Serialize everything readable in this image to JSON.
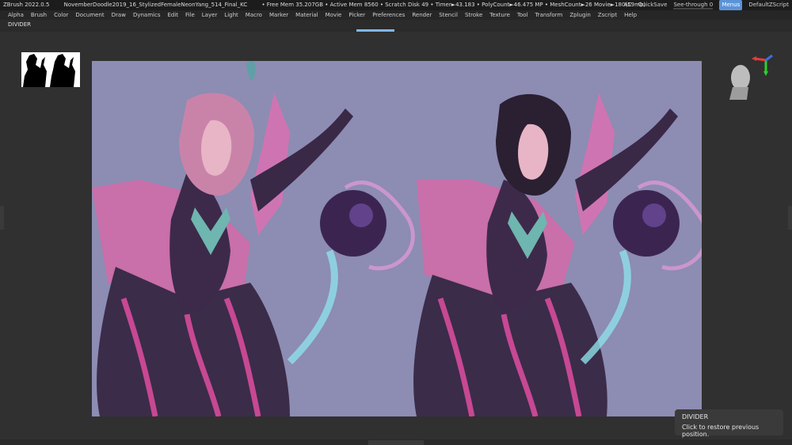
{
  "titlebar": {
    "app": "ZBrush 2022.0.5",
    "file": "NovemberDoodle2019_16_StylizedFemaleNeonYang_514_Final_KC",
    "stats": "• Free Mem 35.207GB • Active Mem 8560 • Scratch Disk 49 • Timer►43.183 • PolyCount►46.475 MP • MeshCount►26  Movie►180(59mb)",
    "ac": "AC",
    "quicksave": "QuickSave",
    "see_through_label": "See-through",
    "see_through_value": "0",
    "see_through_level": 0,
    "menus": "Menus",
    "default_zscript": "DefaultZScript"
  },
  "menubar": {
    "items": [
      "Alpha",
      "Brush",
      "Color",
      "Document",
      "Draw",
      "Dynamics",
      "Edit",
      "File",
      "Layer",
      "Light",
      "Macro",
      "Marker",
      "Material",
      "Movie",
      "Picker",
      "Preferences",
      "Render",
      "Stencil",
      "Stroke",
      "Texture",
      "Tool",
      "Transform",
      "Zplugin",
      "Zscript",
      "Help"
    ]
  },
  "ribbon": {
    "label": "DIVIDER"
  },
  "tooltip": {
    "title": "DIVIDER",
    "body": "Click to restore previous position."
  },
  "colors": {
    "canvas_bg": "#8d8cb3",
    "accent": "#7fb7e8",
    "menus_button": "#5b93d8"
  }
}
